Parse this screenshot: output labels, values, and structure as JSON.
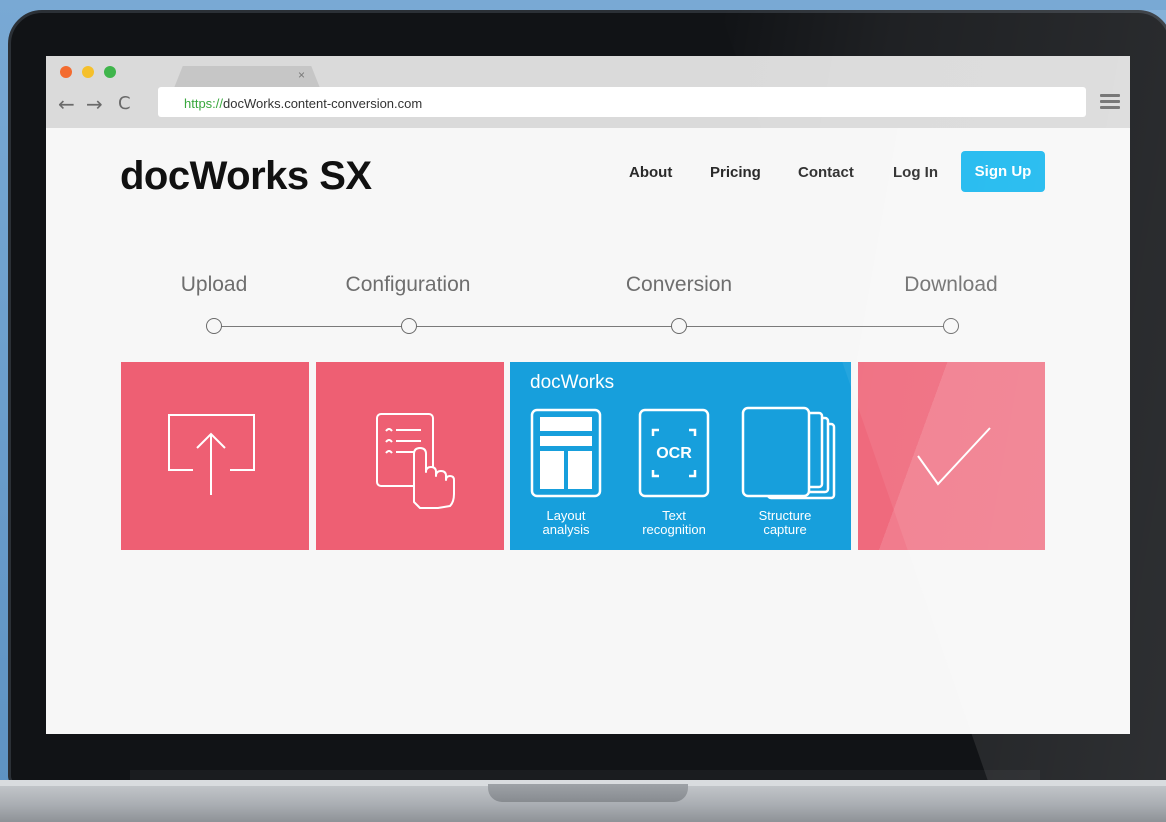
{
  "browser": {
    "url_scheme": "https://",
    "url_rest": "docWorks.content-conversion.com",
    "tab_close": "×",
    "back_icon": "←",
    "forward_icon": "→",
    "reload_icon": "C"
  },
  "site": {
    "logo": "docWorks SX",
    "nav": {
      "about": "About",
      "pricing": "Pricing",
      "contact": "Contact",
      "login": "Log In",
      "signup": "Sign Up"
    },
    "accent": "#1ab8ef"
  },
  "steps": [
    "Upload",
    "Configuration",
    "Conversion",
    "Download"
  ],
  "conversion_card": {
    "title": "docWorks",
    "ocr": "OCR",
    "labels": [
      {
        "line1": "Layout",
        "line2": "analysis"
      },
      {
        "line1": "Text",
        "line2": "recognition"
      },
      {
        "line1": "Structure",
        "line2": "capture"
      }
    ]
  },
  "colors": {
    "card_red": "#ee5f73",
    "card_blue": "#179fdc"
  },
  "icons": [
    "upload-icon",
    "checklist-hand-icon",
    "layout-icon",
    "ocr-icon",
    "stacked-pages-icon",
    "checkmark-icon"
  ]
}
